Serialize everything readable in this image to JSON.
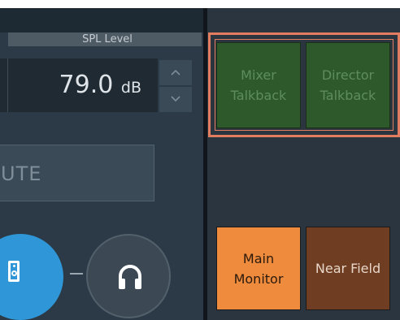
{
  "spl": {
    "header": "SPL Level",
    "value": "79.0",
    "unit": "dB",
    "up_arrow": "^",
    "down_arrow": "v"
  },
  "mute": {
    "label": "UTE"
  },
  "monitor_source": {
    "speaker_icon": "speaker-icon",
    "headphone_icon": "headphone-icon",
    "connector": "—"
  },
  "talkback": {
    "mixer_line1": "Mixer",
    "mixer_line2": "Talkback",
    "director_line1": "Director",
    "director_line2": "Talkback",
    "highlight_color": "#e37d5f",
    "inactive_color": "#2e5a2b"
  },
  "monitors": {
    "main_line1": "Main",
    "main_line2": "Monitor",
    "near_field": "Near Field",
    "main_color": "#ef8b3d",
    "near_color": "#6e3d22"
  }
}
